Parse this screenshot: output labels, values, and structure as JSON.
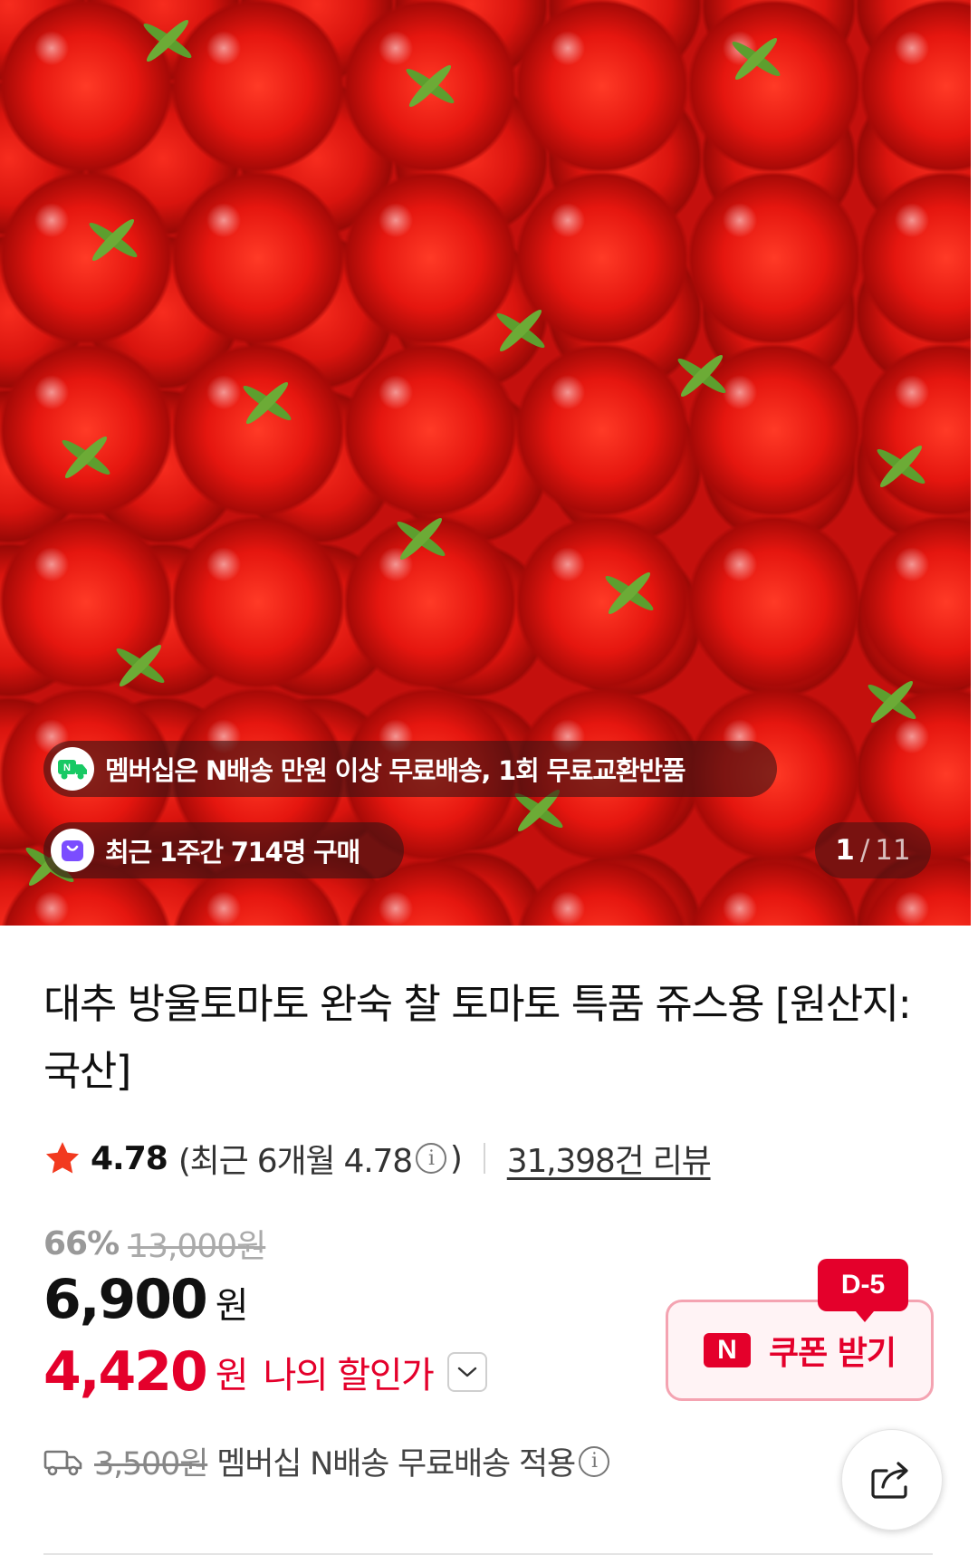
{
  "hero": {
    "membership_banner": "멤버십은 N배송 만원 이상 무료배송, 1회 무료교환반품",
    "recent_purchase_banner": "최근 1주간 714명 구매",
    "image_counter_current": "1",
    "image_counter_separator": "/",
    "image_counter_total": "11",
    "membership_icon_letter": "N"
  },
  "product": {
    "title": "대추 방울토마토 완숙 찰 토마토 특품 쥬스용 [원산지:국산]"
  },
  "rating": {
    "score": "4.78",
    "recent_prefix": "(최근 6개월 4.78",
    "recent_suffix": ")",
    "info_glyph": "i",
    "review_count": "31,398건 리뷰"
  },
  "price": {
    "discount_rate": "66%",
    "original_price": "13,000원",
    "sale_price": "6,900",
    "sale_unit": "원",
    "my_price": "4,420",
    "my_price_unit": "원",
    "my_price_label": "나의 할인가"
  },
  "coupon": {
    "dday": "D-5",
    "brand_letter": "N",
    "label": "쿠폰 받기"
  },
  "delivery": {
    "old_fee": "3,500원",
    "text": "멤버십 N배송 무료배송 적용",
    "info_glyph": "i"
  },
  "colors": {
    "accent": "#e4002b",
    "coupon_bg": "#fff3f5",
    "coupon_border": "#f4a3b1",
    "membership_icon_bg": "#ffffff",
    "purchase_icon_bg": "#7b4dff"
  },
  "icons": [
    "truck-n-icon",
    "shopping-bag-icon",
    "star-icon",
    "info-icon",
    "chevron-down-icon",
    "delivery-truck-icon",
    "share-icon"
  ]
}
